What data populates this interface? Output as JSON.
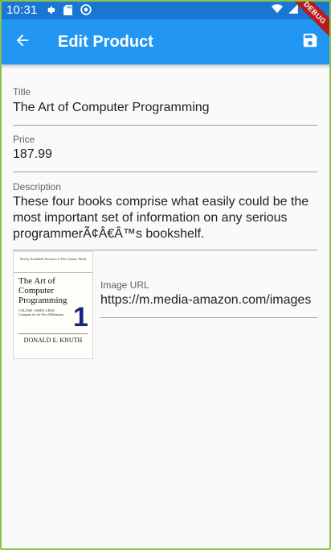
{
  "status_bar": {
    "time": "10:31",
    "icons": [
      "gear-icon",
      "sd-card-icon",
      "sync-icon"
    ],
    "right_icons": [
      "wifi-icon",
      "signal-icon",
      "battery-icon"
    ],
    "debug_label": "DEBUG"
  },
  "app_bar": {
    "title": "Edit Product",
    "back_icon": "arrow-back-icon",
    "save_icon": "save-icon",
    "color": "#2196f3"
  },
  "form": {
    "title": {
      "label": "Title",
      "value": "The Art of Computer Programming"
    },
    "price": {
      "label": "Price",
      "value": "187.99"
    },
    "description": {
      "label": "Description",
      "value": "These four books comprise what easily could be the most important set of information on any serious programmerÃ¢Â€Â™s bookshelf."
    },
    "image_url": {
      "label": "Image URL",
      "value": "https://m.media-amazon.com/images"
    }
  },
  "cover": {
    "top_text": "Newly Available Section of The Classic Work",
    "title": "The Art of Computer Programming",
    "volume_text": "VOLUME 1 MMIX A RISC Computer for the New Millennium",
    "number": "1",
    "author": "DONALD E. KNUTH"
  }
}
